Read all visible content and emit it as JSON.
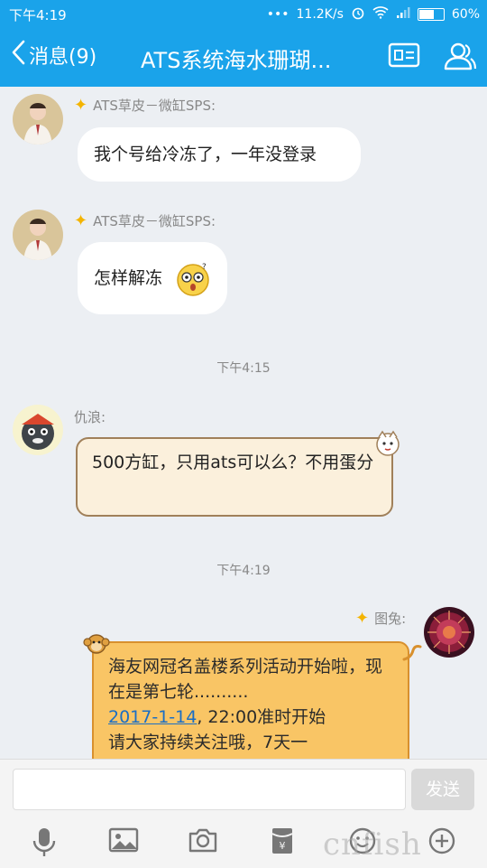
{
  "status_bar": {
    "time": "下午4:19",
    "dots": "•••",
    "network_speed": "11.2K/s",
    "battery": "60%",
    "battery_level": 0.6
  },
  "header": {
    "back_label": "消息(9)",
    "title": "ATS系统海水珊瑚...",
    "profile_icon": "id-card-icon",
    "group_icon": "group-members-icon"
  },
  "messages": [
    {
      "sender": "ATS草皮－微缸SPS:",
      "text": "我个号给冷冻了，一年没登录"
    },
    {
      "sender": "ATS草皮－微缸SPS:",
      "text": "怎样解冻"
    },
    {
      "timestamp": "下午4:15"
    },
    {
      "sender": "仇浪:",
      "text": "500方缸，只用ats可以么？不用蛋分"
    },
    {
      "timestamp": "下午4:19"
    },
    {
      "sender": "图兔:",
      "text_line1": "海友网冠名盖楼系列活动开始啦，现在是第七轮..........",
      "link": "2017-1-14",
      "text_after_link": ", 22:00准时开始",
      "text_line4": "请大家持续关注哦，7天一"
    }
  ],
  "input_bar": {
    "placeholder": "",
    "send_label": "发送",
    "tools": [
      "microphone-icon",
      "image-icon",
      "camera-icon",
      "red-packet-icon",
      "emoji-icon",
      "plus-icon"
    ]
  },
  "watermark": "cnfish",
  "colors": {
    "header_blue": "#1aa3ea",
    "background": "#eceff3",
    "orange_bubble": "#f9c565",
    "tan_bubble": "#fbf0dc"
  }
}
